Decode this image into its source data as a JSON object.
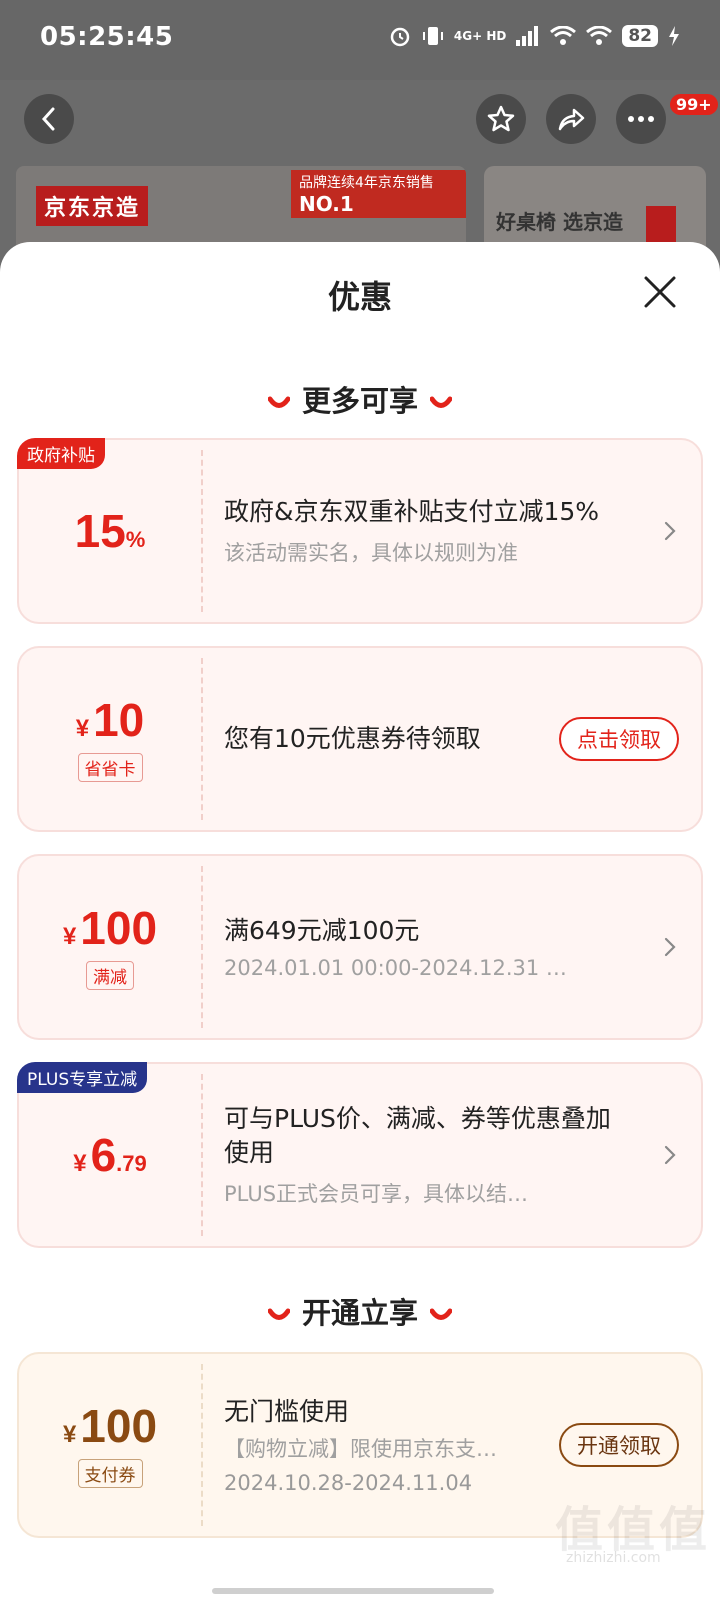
{
  "status_bar": {
    "time": "05:25:45",
    "network": "4G+ HD",
    "battery": "82"
  },
  "nav": {
    "more_badge": "99+"
  },
  "background": {
    "brand_tag": "京东京造",
    "rank_banner_prefix": "品牌连续4年京东销售",
    "rank_banner_emph": "NO.1",
    "side_banner": "好桌椅 选京造"
  },
  "sheet": {
    "title": "优惠",
    "section1_title": "更多可享",
    "section2_title": "开通立享"
  },
  "cards": [
    {
      "corner_tag": "政府补贴",
      "amount": "15",
      "unit": "%",
      "title": "政府&京东双重补贴支付立减15%",
      "subtitle": "该活动需实名，具体以规则为准"
    },
    {
      "yen": "¥",
      "amount": "10",
      "tag": "省省卡",
      "title": "您有10元优惠券待领取",
      "button": "点击领取"
    },
    {
      "yen": "¥",
      "amount": "100",
      "tag": "满减",
      "title": "满649元减100元",
      "subtitle": "2024.01.01 00:00-2024.12.31 …"
    },
    {
      "corner_tag": "PLUS专享立减",
      "yen": "¥",
      "amount": "6",
      "amount_decimal": ".79",
      "title": "可与PLUS价、满减、券等优惠叠加使用",
      "subtitle": "PLUS正式会员可享，具体以结…"
    },
    {
      "yen": "¥",
      "amount": "100",
      "tag": "支付券",
      "title": "无门槛使用",
      "subtitle": "【购物立减】限使用京东支…",
      "date": "2024.10.28-2024.11.04",
      "button": "开通领取"
    }
  ],
  "watermark": {
    "text": "值值值",
    "url": "zhizhizhi.com"
  },
  "colors": {
    "accent_red": "#e2231a",
    "plus_blue": "#27348b",
    "gold_brown": "#8a4a12"
  }
}
